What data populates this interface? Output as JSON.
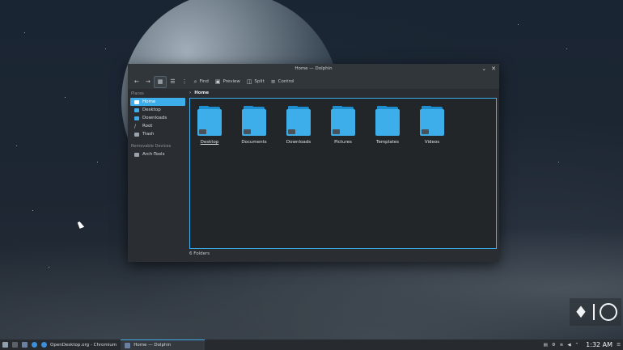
{
  "window": {
    "title": "Home — Dolphin"
  },
  "toolbar": {
    "find_label": "Find",
    "preview_label": "Preview",
    "split_label": "Split",
    "control_label": "Control"
  },
  "sidebar": {
    "places_title": "Places",
    "places": [
      {
        "label": "Home",
        "icon": "home-icon",
        "selected": true
      },
      {
        "label": "Desktop",
        "icon": "desktop-icon"
      },
      {
        "label": "Downloads",
        "icon": "downloads-icon"
      },
      {
        "label": "Root",
        "icon": "root-icon"
      },
      {
        "label": "Trash",
        "icon": "trash-icon"
      }
    ],
    "removable_title": "Removable Devices",
    "devices": [
      {
        "label": "Arch-Tools",
        "icon": "drive-icon"
      }
    ]
  },
  "breadcrumb": {
    "current": "Home"
  },
  "files": [
    {
      "name": "Desktop",
      "icon": "folder-desktop-icon"
    },
    {
      "name": "Documents",
      "icon": "folder-documents-icon"
    },
    {
      "name": "Downloads",
      "icon": "folder-downloads-icon"
    },
    {
      "name": "Pictures",
      "icon": "folder-pictures-icon"
    },
    {
      "name": "Templates",
      "icon": "folder-templates-icon"
    },
    {
      "name": "Videos",
      "icon": "folder-videos-icon"
    }
  ],
  "status": {
    "text": "6 Folders"
  },
  "taskbar": {
    "tasks": [
      {
        "label": "OpenDesktop.org - Chromium"
      },
      {
        "label": "Home — Dolphin",
        "active": true
      }
    ],
    "clock": "1:32 AM"
  },
  "colors": {
    "accent": "#3daee9",
    "window_bg": "#2a2e32",
    "titlebar_bg": "#31363b"
  }
}
